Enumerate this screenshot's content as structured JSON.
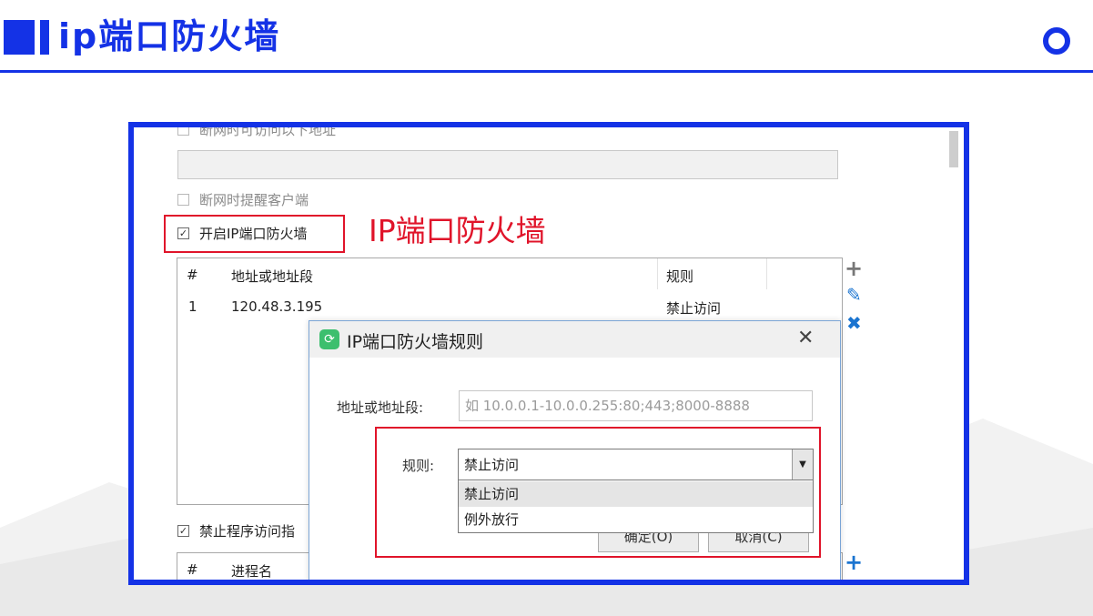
{
  "slide": {
    "title": "ip端口防火墙",
    "accent_color": "#1432e6"
  },
  "settings": {
    "truncated_option_label": "断网时可访问以下地址",
    "remind_client_label": "断网时提醒客户端",
    "enable_firewall_label": "开启IP端口防火墙",
    "enable_firewall_checked": true,
    "block_program_label": "禁止程序访问指",
    "block_program_checked": true
  },
  "annotation": {
    "text": "IP端口防火墙",
    "color": "#e0142a"
  },
  "ip_table": {
    "columns": [
      "#",
      "地址或地址段",
      "规则"
    ],
    "rows": [
      {
        "index": "1",
        "address": "120.48.3.195",
        "rule": "禁止访问"
      }
    ]
  },
  "program_table": {
    "columns": [
      "#",
      "进程名"
    ]
  },
  "side_actions": {
    "add": "+",
    "edit": "✎",
    "delete": "✖",
    "add_program": "+"
  },
  "dialog": {
    "title": "IP端口防火墙规则",
    "close_glyph": "✕",
    "address_label": "地址或地址段:",
    "address_placeholder": "如 10.0.0.1-10.0.0.255:80;443;8000-8888",
    "rule_label": "规则:",
    "rule_value": "禁止访问",
    "rule_options": [
      "禁止访问",
      "例外放行"
    ],
    "ok_button": "确定(O)",
    "cancel_button": "取消(C)"
  }
}
